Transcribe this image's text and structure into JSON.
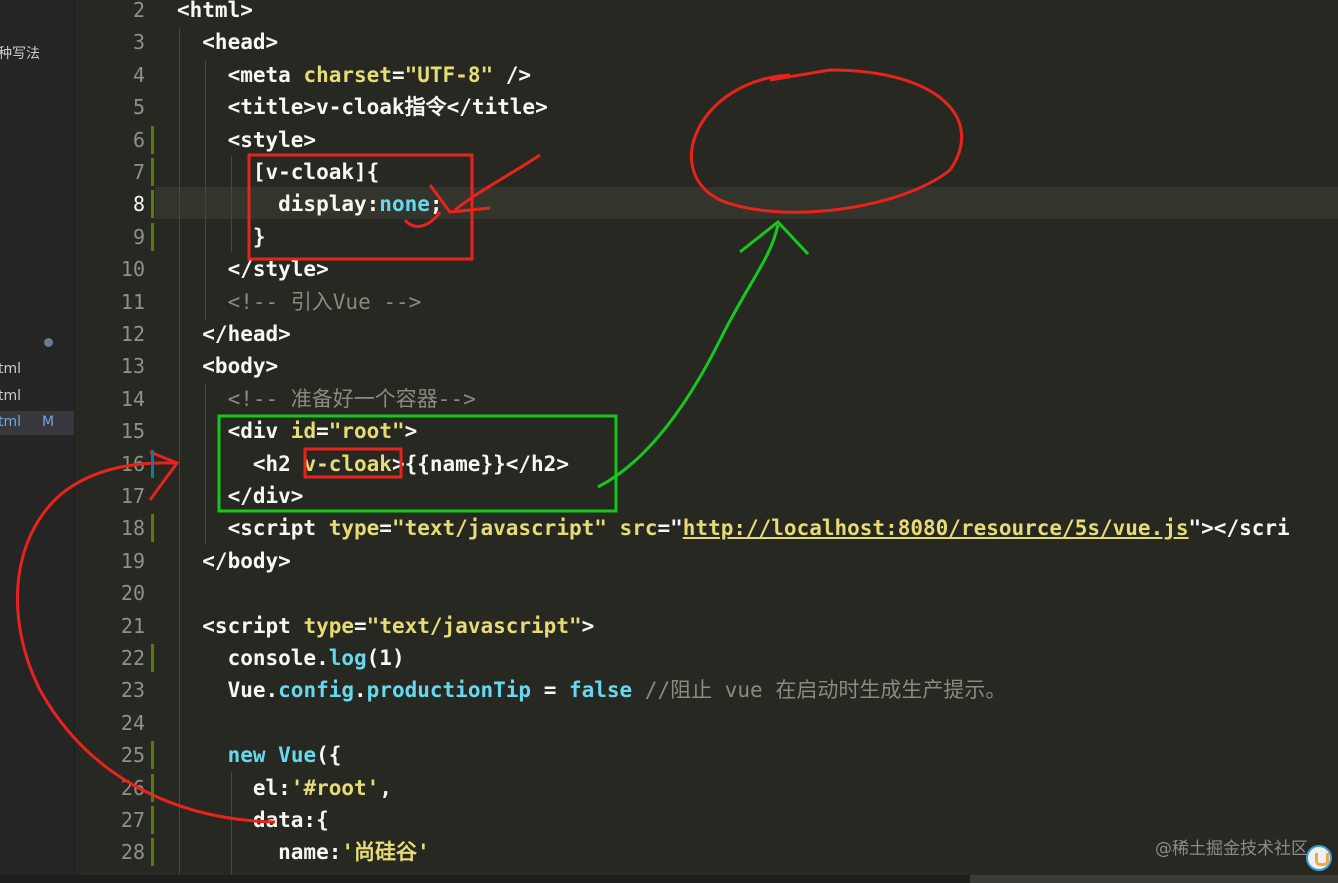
{
  "sidebar": {
    "section_label": "种写法",
    "files": [
      {
        "name": "tml",
        "badge": ""
      },
      {
        "name": "tml",
        "badge": ""
      },
      {
        "name": "tml",
        "badge": "M"
      }
    ]
  },
  "editor": {
    "current_line": 8,
    "lines": [
      {
        "n": "2",
        "tokens": [
          {
            "c": "t-tag",
            "t": "<html>"
          }
        ]
      },
      {
        "n": "3",
        "tokens": [
          {
            "c": "t-tag",
            "t": "  <head>"
          }
        ]
      },
      {
        "n": "4",
        "tokens": [
          {
            "c": "t-tag",
            "t": "    <meta "
          },
          {
            "c": "t-attr",
            "t": "charset"
          },
          {
            "c": "t-tag",
            "t": "="
          },
          {
            "c": "t-str",
            "t": "\"UTF-8\""
          },
          {
            "c": "t-tag",
            "t": " />"
          }
        ]
      },
      {
        "n": "5",
        "tokens": [
          {
            "c": "t-tag",
            "t": "    <title>v-cloak指令</title>"
          }
        ]
      },
      {
        "n": "6",
        "tokens": [
          {
            "c": "t-tag",
            "t": "    <style>"
          }
        ]
      },
      {
        "n": "7",
        "tokens": [
          {
            "c": "t-tag",
            "t": "      [v-cloak]{"
          }
        ]
      },
      {
        "n": "8",
        "tokens": [
          {
            "c": "t-tag",
            "t": "        display:"
          },
          {
            "c": "t-val",
            "t": "none"
          },
          {
            "c": "t-tag",
            "t": ";"
          }
        ]
      },
      {
        "n": "9",
        "tokens": [
          {
            "c": "t-tag",
            "t": "      }"
          }
        ]
      },
      {
        "n": "10",
        "tokens": [
          {
            "c": "t-tag",
            "t": "    </style>"
          }
        ]
      },
      {
        "n": "11",
        "tokens": [
          {
            "c": "t-cm",
            "t": "    <!-- 引入Vue -->"
          }
        ]
      },
      {
        "n": "12",
        "tokens": [
          {
            "c": "t-tag",
            "t": "  </head>"
          }
        ]
      },
      {
        "n": "13",
        "tokens": [
          {
            "c": "t-tag",
            "t": "  <body>"
          }
        ]
      },
      {
        "n": "14",
        "tokens": [
          {
            "c": "t-cm",
            "t": "    <!-- 准备好一个容器-->"
          }
        ]
      },
      {
        "n": "15",
        "tokens": [
          {
            "c": "t-tag",
            "t": "    <div "
          },
          {
            "c": "t-attr",
            "t": "id"
          },
          {
            "c": "t-tag",
            "t": "="
          },
          {
            "c": "t-str",
            "t": "\"root\""
          },
          {
            "c": "t-tag",
            "t": ">"
          }
        ]
      },
      {
        "n": "16",
        "tokens": [
          {
            "c": "t-tag",
            "t": "      <h2 "
          },
          {
            "c": "t-attr",
            "t": "v-cloak"
          },
          {
            "c": "t-tag",
            "t": ">{{name}}</h2>"
          }
        ]
      },
      {
        "n": "17",
        "tokens": [
          {
            "c": "t-tag",
            "t": "    </div>"
          }
        ]
      },
      {
        "n": "18",
        "tokens": [
          {
            "c": "t-tag",
            "t": "    <script "
          },
          {
            "c": "t-attr",
            "t": "type"
          },
          {
            "c": "t-tag",
            "t": "="
          },
          {
            "c": "t-str",
            "t": "\"text/javascript\""
          },
          {
            "c": "t-tag",
            "t": " "
          },
          {
            "c": "t-attr",
            "t": "src"
          },
          {
            "c": "t-tag",
            "t": "=\""
          },
          {
            "c": "t-url",
            "t": "http://localhost:8080/resource/5s/vue.js"
          },
          {
            "c": "t-tag",
            "t": "\"></scri"
          }
        ]
      },
      {
        "n": "19",
        "tokens": [
          {
            "c": "t-tag",
            "t": "  </body>"
          }
        ]
      },
      {
        "n": "20",
        "tokens": []
      },
      {
        "n": "21",
        "tokens": [
          {
            "c": "t-tag",
            "t": "  <script "
          },
          {
            "c": "t-attr",
            "t": "type"
          },
          {
            "c": "t-tag",
            "t": "="
          },
          {
            "c": "t-str",
            "t": "\"text/javascript\""
          },
          {
            "c": "t-tag",
            "t": ">"
          }
        ]
      },
      {
        "n": "22",
        "tokens": [
          {
            "c": "t-tag",
            "t": "    console."
          },
          {
            "c": "t-kw",
            "t": "log"
          },
          {
            "c": "t-tag",
            "t": "(1)"
          }
        ]
      },
      {
        "n": "23",
        "tokens": [
          {
            "c": "t-tag",
            "t": "    Vue."
          },
          {
            "c": "t-kw",
            "t": "config"
          },
          {
            "c": "t-tag",
            "t": "."
          },
          {
            "c": "t-kw",
            "t": "productionTip"
          },
          {
            "c": "t-tag",
            "t": " = "
          },
          {
            "c": "t-kw",
            "t": "false"
          },
          {
            "c": "t-cm",
            "t": " //阻止 vue 在启动时生成生产提示。"
          }
        ]
      },
      {
        "n": "24",
        "tokens": []
      },
      {
        "n": "25",
        "tokens": [
          {
            "c": "t-kw",
            "t": "    new"
          },
          {
            "c": "t-tag",
            "t": " "
          },
          {
            "c": "t-kw",
            "t": "Vue"
          },
          {
            "c": "t-tag",
            "t": "({"
          }
        ]
      },
      {
        "n": "26",
        "tokens": [
          {
            "c": "t-tag",
            "t": "      el:"
          },
          {
            "c": "t-str",
            "t": "'#root'"
          },
          {
            "c": "t-tag",
            "t": ","
          }
        ]
      },
      {
        "n": "27",
        "tokens": [
          {
            "c": "t-tag",
            "t": "      data:{"
          }
        ]
      },
      {
        "n": "28",
        "tokens": [
          {
            "c": "t-tag",
            "t": "        name:"
          },
          {
            "c": "t-str",
            "t": "'尚硅谷'"
          }
        ]
      }
    ]
  },
  "watermark": {
    "text": "@稀土掘金技术社区"
  },
  "colors": {
    "background": "#272822",
    "annotation_red": "#e8231c",
    "annotation_green": "#16c81e"
  }
}
